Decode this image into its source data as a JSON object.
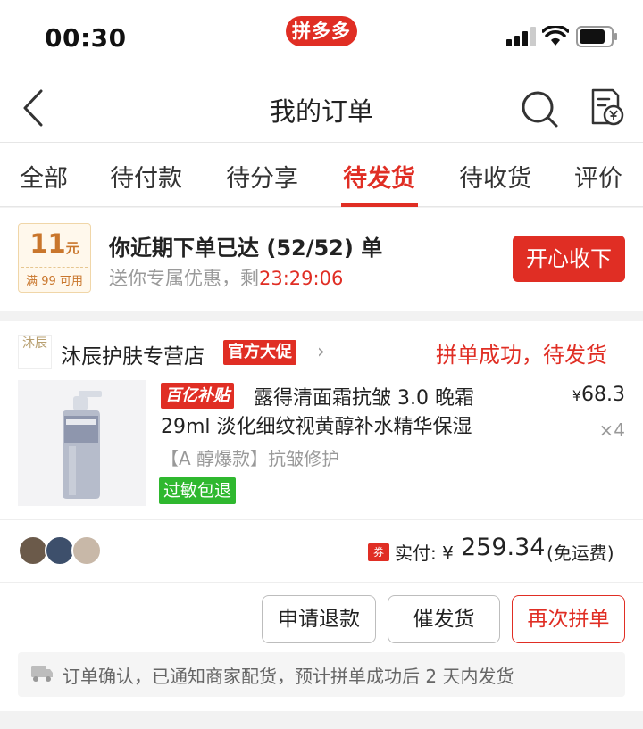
{
  "status_bar": {
    "time": "00:30",
    "brand": "拼多多"
  },
  "nav": {
    "title": "我的订单"
  },
  "tabs": [
    {
      "label": "全部",
      "active": false
    },
    {
      "label": "待付款",
      "active": false
    },
    {
      "label": "待分享",
      "active": false
    },
    {
      "label": "待发货",
      "active": true
    },
    {
      "label": "待收货",
      "active": false
    },
    {
      "label": "评价",
      "active": false
    }
  ],
  "promo": {
    "coupon_value": "11",
    "coupon_unit": "元",
    "coupon_condition": "满 99 可用",
    "headline": "你近期下单已达 (52/52) 单",
    "subtext": "送你专属优惠，剩",
    "countdown": "23:29:06",
    "button": "开心收下"
  },
  "order": {
    "shop_logo": "沐辰",
    "shop_name": "沐辰护肤专营店",
    "shop_badge": "官方大促",
    "status": "拼单成功，待发货",
    "subsidy_tag": "百亿补贴",
    "title_line1": "露得清面霜抗皱 3.0 晚霜",
    "title_line2": "29ml 淡化细纹视黄醇补水精华保湿",
    "spec": "【A 醇爆款】抗皱修护",
    "guarantee": "过敏包退",
    "currency": "¥",
    "price": "68.3",
    "quantity": "×4",
    "paid_badge": "券",
    "paid_label": "实付:",
    "paid_amount": "259.34",
    "paid_note": "(免运费)",
    "actions": {
      "refund": "申请退款",
      "urge": "催发货",
      "reorder": "再次拼单"
    },
    "notice": "订单确认，已通知商家配货，预计拼单成功后 2 天内发货"
  },
  "colors": {
    "accent": "#e02e24",
    "green": "#2fb82f",
    "coupon_gold": "#c9762c"
  }
}
